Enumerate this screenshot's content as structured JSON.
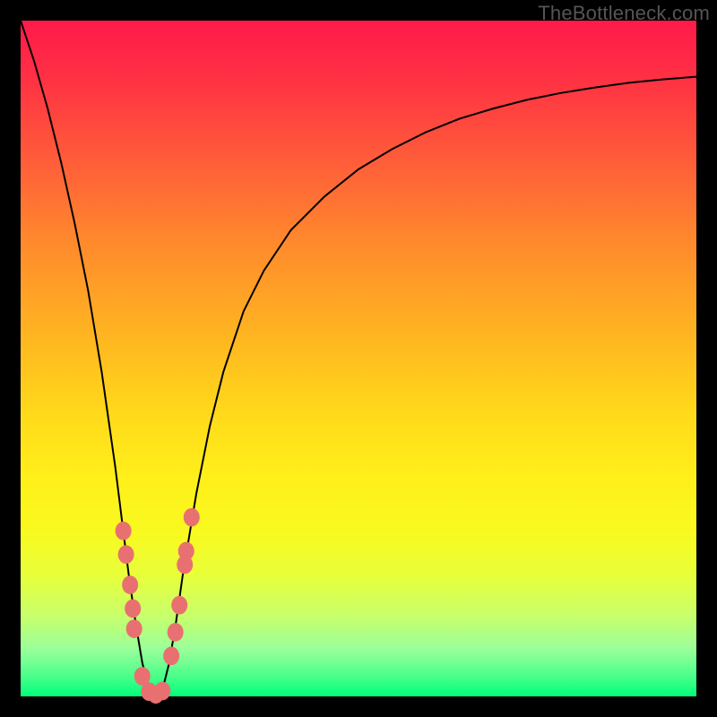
{
  "watermark": "TheBottleneck.com",
  "colors": {
    "dot": "#e97070",
    "curve": "#000000",
    "gradient_top": "#ff1a4a",
    "gradient_bottom": "#00ff7a",
    "frame": "#000000"
  },
  "chart_data": {
    "type": "line",
    "title": "",
    "xlabel": "",
    "ylabel": "",
    "xlim": [
      0,
      100
    ],
    "ylim": [
      0,
      100
    ],
    "x_is_component_scale_pct": true,
    "y_is_bottleneck_pct": true,
    "series": [
      {
        "name": "bottleneck-curve",
        "x": [
          0,
          2,
          4,
          6,
          8,
          10,
          12,
          14,
          16,
          17,
          18,
          19,
          20,
          21,
          22,
          23,
          24,
          26,
          28,
          30,
          33,
          36,
          40,
          45,
          50,
          55,
          60,
          65,
          70,
          75,
          80,
          85,
          90,
          95,
          100
        ],
        "y": [
          100,
          94,
          87,
          79,
          70,
          60,
          48,
          34,
          18,
          11,
          5,
          1,
          0,
          1,
          5,
          11,
          18,
          30,
          40,
          48,
          57,
          63,
          69,
          74,
          78,
          81,
          83.5,
          85.5,
          87,
          88.3,
          89.3,
          90.1,
          90.8,
          91.3,
          91.7
        ]
      }
    ],
    "points": [
      {
        "x": 15.2,
        "y": 24.5
      },
      {
        "x": 15.6,
        "y": 21.0
      },
      {
        "x": 16.2,
        "y": 16.5
      },
      {
        "x": 16.6,
        "y": 13.0
      },
      {
        "x": 16.8,
        "y": 10.0
      },
      {
        "x": 18.0,
        "y": 3.0
      },
      {
        "x": 19.0,
        "y": 0.7
      },
      {
        "x": 20.0,
        "y": 0.3
      },
      {
        "x": 21.0,
        "y": 0.8
      },
      {
        "x": 22.3,
        "y": 6.0
      },
      {
        "x": 22.9,
        "y": 9.5
      },
      {
        "x": 23.5,
        "y": 13.5
      },
      {
        "x": 24.3,
        "y": 19.5
      },
      {
        "x": 24.5,
        "y": 21.5
      },
      {
        "x": 25.3,
        "y": 26.5
      }
    ],
    "optimal_x": 20,
    "annotations": []
  }
}
